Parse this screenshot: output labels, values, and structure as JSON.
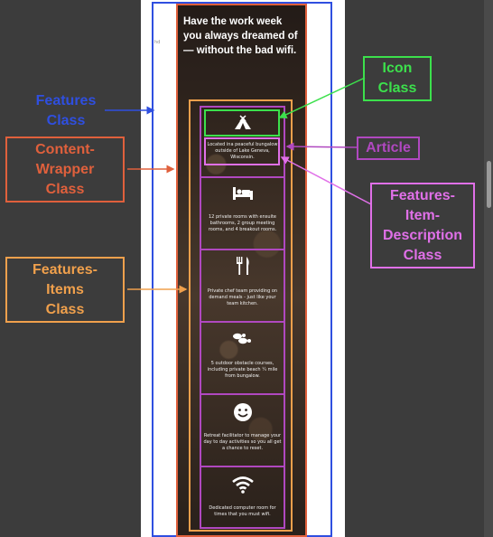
{
  "tiny_label": "hd",
  "headline": "Have the work week you always dreamed of — without the bad wifi.",
  "features": [
    {
      "icon": "tent-icon",
      "text": "Located ina peaceful bungalow outside of Lake Geneva, Wisconsin."
    },
    {
      "icon": "bed-icon",
      "text": "12 private rooms with ensuite bathrooms, 2 group meeting rooms, and 4 breakout rooms."
    },
    {
      "icon": "fork-knife-icon",
      "text": "Private chef team providing on demand meals - just like your team kitchen."
    },
    {
      "icon": "footprints-icon",
      "text": "5 outdoor obstacle courses, including private beach ¼ mile from bungalow."
    },
    {
      "icon": "smile-icon",
      "text": "Retreat facilitator to manage your day to day activities so you all get a chance to reset."
    },
    {
      "icon": "wifi-icon",
      "text": "Dedicated computer room for times that you must wifi."
    }
  ],
  "annotations": {
    "features_class": "Features Class",
    "content_wrapper_class": "Content-Wrapper Class",
    "features_items_class": "Features-Items Class",
    "icon_class": "Icon Class",
    "article": "Article",
    "features_item_description_class": "Features-Item-Description Class"
  },
  "colors": {
    "features": "#2f4fe0",
    "content_wrapper": "#e0603c",
    "features_items": "#f0a04c",
    "icon": "#3ce04c",
    "article": "#b048c0",
    "description": "#e070e8"
  }
}
